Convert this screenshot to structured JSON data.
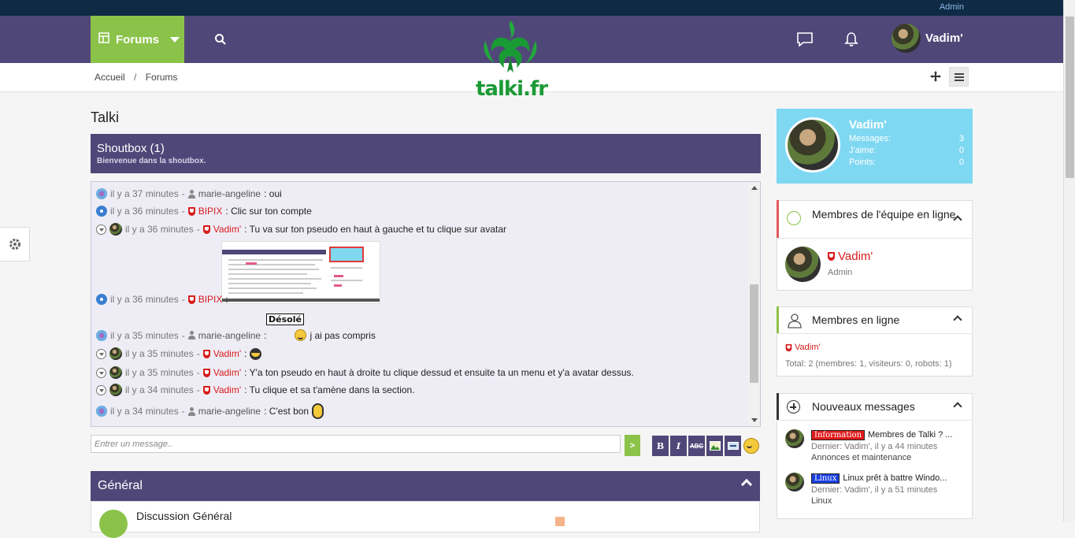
{
  "topstrip": {
    "admin_link": "Admin"
  },
  "navbar": {
    "forums_label": "Forums",
    "user_name": "Vadim'"
  },
  "logo": {
    "text": "talki.fr"
  },
  "breadcrumb": {
    "home": "Accueil",
    "separator": "/",
    "current": "Forums"
  },
  "page": {
    "title": "Talki"
  },
  "shoutbox": {
    "title": "Shoutbox (1)",
    "subtitle": "Bienvenue dans la shoutbox.",
    "input_placeholder": "Entrer un message..",
    "send_label": ">",
    "messages": [
      {
        "time": "il y a 37 minutes",
        "user": "marie-angeline",
        "text": ": oui"
      },
      {
        "time": "il y a 36 minutes",
        "user": "BIPIX",
        "text": ": Clic sur ton compte"
      },
      {
        "time": "il y a 36 minutes",
        "user": "Vadim'",
        "text": ": Tu va sur ton pseudo en haut à gauche et tu clique sur avatar"
      },
      {
        "time": "il y a 36 minutes",
        "user": "BIPIX",
        "text": ":"
      },
      {
        "time": "il y a 35 minutes",
        "user": "marie-angeline",
        "text": ":",
        "after": "j ai pas compris",
        "sign": "Désolé"
      },
      {
        "time": "il y a 35 minutes",
        "user": "Vadim'",
        "text": ":"
      },
      {
        "time": "il y a 35 minutes",
        "user": "Vadim'",
        "text": ": Y'a ton pseudo en haut à droite tu clique dessud et ensuite ta un menu et y'a avatar dessus."
      },
      {
        "time": "il y a 34 minutes",
        "user": "Vadim'",
        "text": ": Tu clique et sa t'amène dans la section."
      },
      {
        "time": "il y a 34 minutes",
        "user": "marie-angeline",
        "text": ": C'est bon"
      }
    ],
    "separator": "-",
    "toolbar": {
      "bold": "B",
      "italic": "I",
      "strike": "ABC"
    }
  },
  "general": {
    "title": "Général",
    "first_forum": "Discussion Général"
  },
  "profile": {
    "name": "Vadim'",
    "stats": [
      {
        "label": "Messages:",
        "value": "3"
      },
      {
        "label": "J'aime:",
        "value": "0"
      },
      {
        "label": "Points:",
        "value": "0"
      }
    ]
  },
  "team_widget": {
    "title": "Membres de l'équipe en ligne",
    "member_name": "Vadim'",
    "member_role": "Admin"
  },
  "online_widget": {
    "title": "Membres en ligne",
    "member_name": "Vadim'",
    "total": "Total: 2 (membres: 1, visiteurs: 0, robots: 1)"
  },
  "news_widget": {
    "title": "Nouveaux messages",
    "items": [
      {
        "tag": "Information",
        "title": "Membres de Talki ? ...",
        "last": "Dernier: Vadim', il y a 44 minutes",
        "forum": "Annonces et maintenance"
      },
      {
        "tag": "Linux",
        "title": "Linux prêt à battre Windo...",
        "last": "Dernier: Vadim', il y a 51 minutes",
        "forum": "Linux"
      }
    ]
  },
  "colors": {
    "nav": "#504779",
    "accent_green": "#8bc34a",
    "profile_bg": "#7fd8f2",
    "admin_red": "#d81b1b"
  }
}
